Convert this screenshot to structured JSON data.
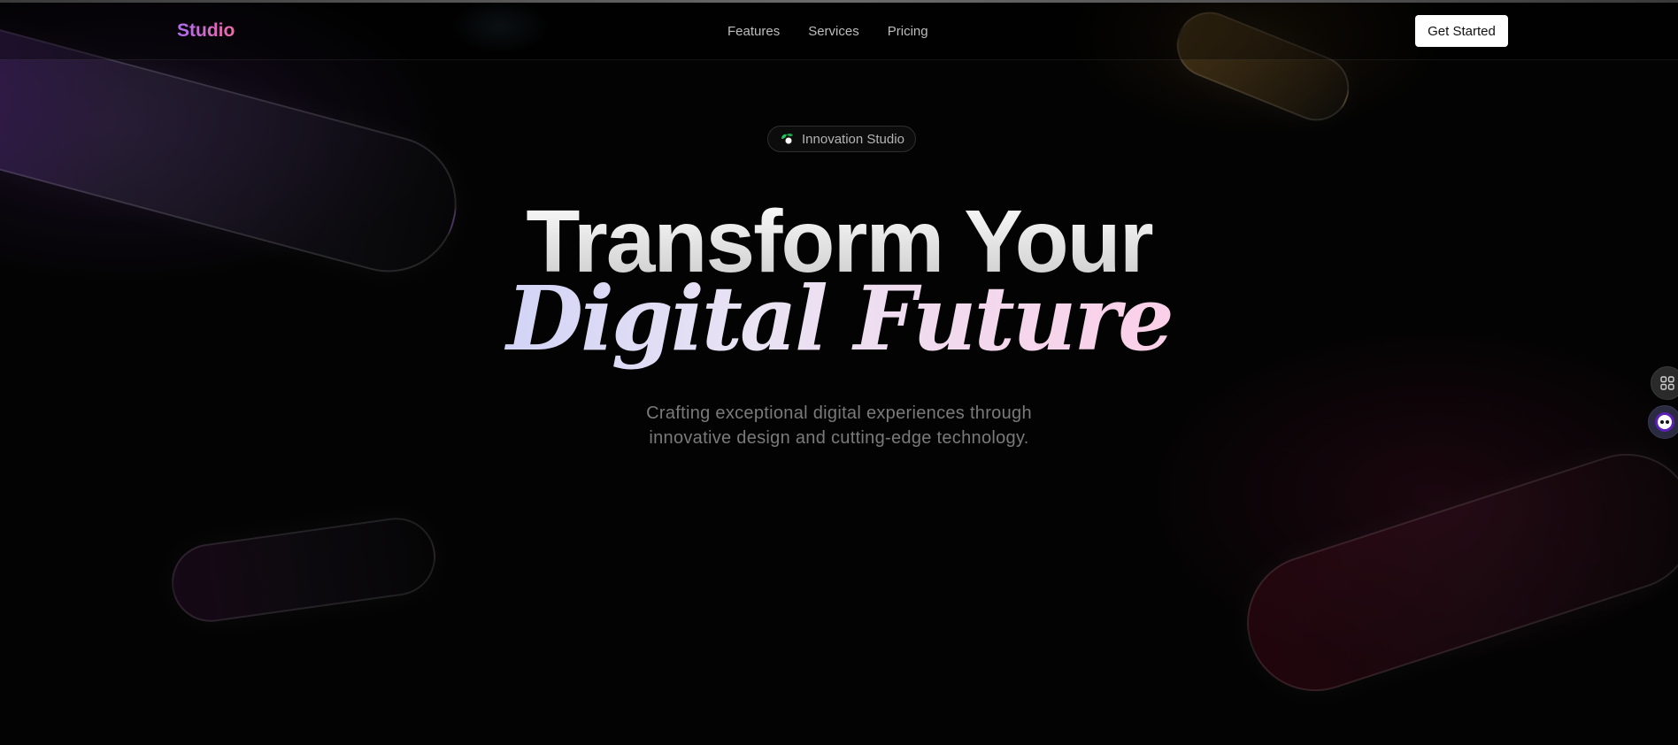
{
  "header": {
    "logo": "Studio",
    "nav": [
      {
        "label": "Features"
      },
      {
        "label": "Services"
      },
      {
        "label": "Pricing"
      }
    ],
    "cta_label": "Get Started"
  },
  "badge": {
    "label": "Innovation Studio",
    "icon": "sprout-icon"
  },
  "hero": {
    "title_line1": "Transform Your",
    "title_line2": "Digital Future",
    "description_line1": "Crafting exceptional digital experiences through",
    "description_line2": "innovative design and cutting-edge technology."
  },
  "side_actions": [
    {
      "icon": "grid-icon"
    },
    {
      "icon": "assistant-icon"
    }
  ],
  "colors": {
    "background": "#030303",
    "logo_gradient": [
      "#b06cf0",
      "#f06aa6"
    ],
    "accent_gradient": [
      "#a5b4fc",
      "#fbcfe8",
      "#f472b6"
    ]
  }
}
